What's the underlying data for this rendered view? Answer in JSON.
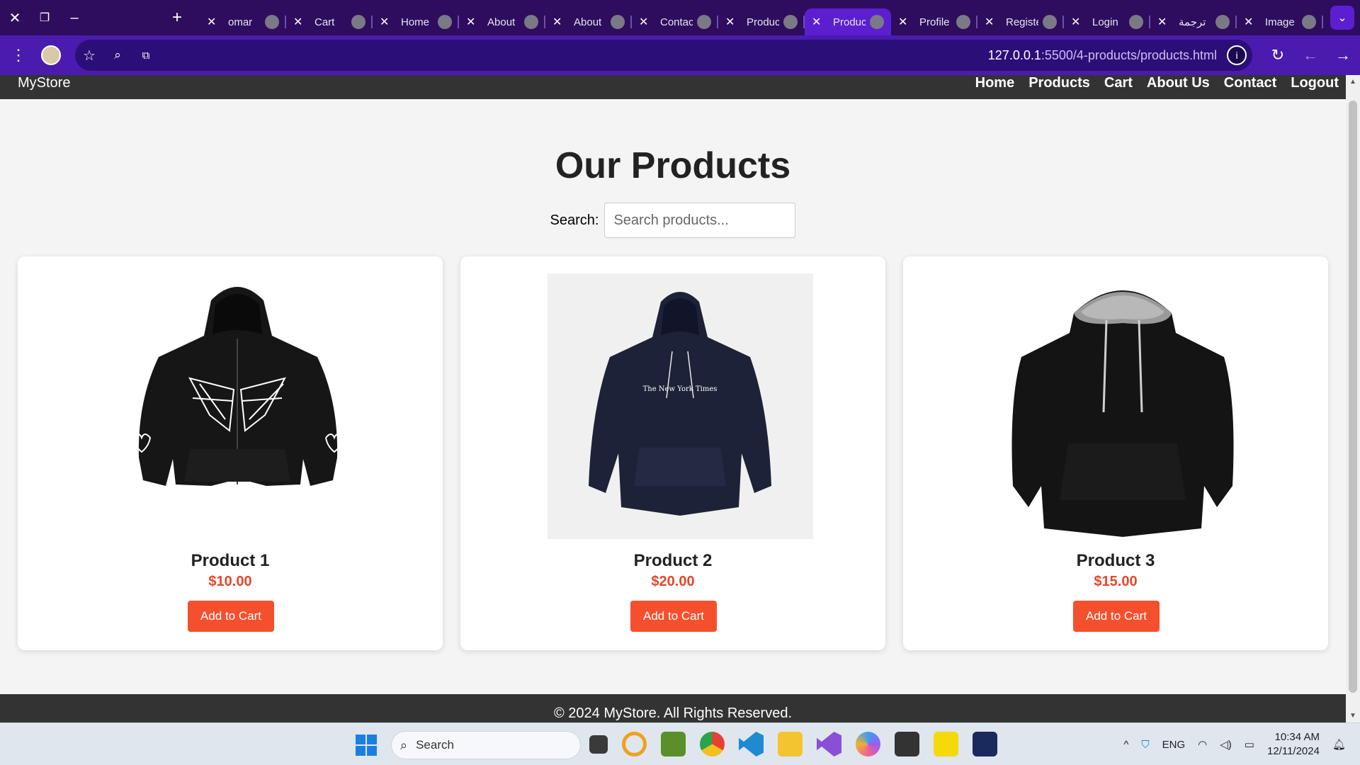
{
  "browser": {
    "tabs": [
      {
        "title": "omar",
        "active": false
      },
      {
        "title": "Cart",
        "active": false
      },
      {
        "title": "Home",
        "active": false
      },
      {
        "title": "About",
        "active": false
      },
      {
        "title": "About",
        "active": false
      },
      {
        "title": "Contact",
        "active": false
      },
      {
        "title": "Products",
        "active": false
      },
      {
        "title": "Products",
        "active": true
      },
      {
        "title": "Profile",
        "active": false
      },
      {
        "title": "Register",
        "active": false
      },
      {
        "title": "Login",
        "active": false
      },
      {
        "title": "ترجمة",
        "active": false
      },
      {
        "title": "Image",
        "active": false
      }
    ],
    "url_host": "127.0.0.1",
    "url_path": ":5500/4-products/products.html"
  },
  "site": {
    "brand": "MyStore",
    "nav": [
      "Home",
      "Products",
      "Cart",
      "About Us",
      "Contact",
      "Logout"
    ],
    "title": "Our Products",
    "search_label": "Search:",
    "search_placeholder": "Search products...",
    "products": [
      {
        "name": "Product 1",
        "price": "$10.00",
        "button": "Add to Cart",
        "image": "black-spiderweb-zip-hoodie"
      },
      {
        "name": "Product 2",
        "price": "$20.00",
        "button": "Add to Cart",
        "image": "navy-nyt-hoodie"
      },
      {
        "name": "Product 3",
        "price": "$15.00",
        "button": "Add to Cart",
        "image": "black-gray-hood-hoodie"
      }
    ],
    "footer": "© 2024 MyStore. All Rights Reserved."
  },
  "taskbar": {
    "search_placeholder": "Search",
    "language": "ENG",
    "time": "10:34 AM",
    "date": "12/11/2024"
  },
  "colors": {
    "tabstrip": "#2e0d5e",
    "addressbar": "#4b1bb0",
    "header": "#333333",
    "accent": "#f5502e",
    "price": "#e8462a"
  }
}
